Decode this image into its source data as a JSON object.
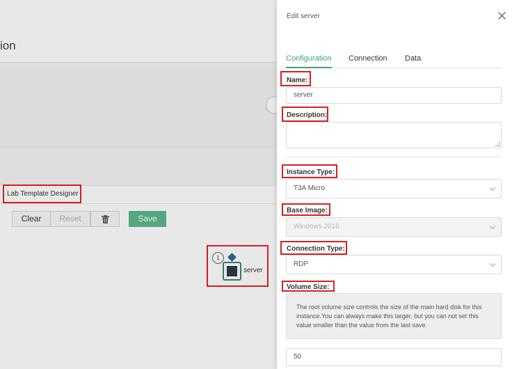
{
  "background": {
    "header_title": "ion",
    "designer_title": "Lab Template Designer",
    "toolbar": {
      "clear_label": "Clear",
      "reset_label": "Reset",
      "delete_icon": "trash-icon",
      "save_label": "Save"
    },
    "node": {
      "number": "1",
      "label": "server"
    }
  },
  "panel": {
    "title": "Edit server",
    "close_icon": "close-icon",
    "tabs": [
      {
        "label": "Configuration",
        "active": true
      },
      {
        "label": "Connection",
        "active": false
      },
      {
        "label": "Data",
        "active": false
      }
    ],
    "fields": {
      "name": {
        "label": "Name:",
        "value": "server"
      },
      "description": {
        "label": "Description:",
        "value": ""
      },
      "instance_type": {
        "label": "Instance Type:",
        "value": "T3A Micro"
      },
      "base_image": {
        "label": "Base Image:",
        "value": "Windows 2016"
      },
      "connection_type": {
        "label": "Connection Type:",
        "value": "RDP"
      },
      "volume_size": {
        "label": "Volume Size:",
        "info": "The root volume size controls the size of the main hard disk for this instance.You can always make this larger, but you can not set this value smaller than the value from the last save.",
        "value": "50"
      }
    }
  },
  "colors": {
    "accent": "#3aa37c",
    "save_button": "#5cb890",
    "annotation": "#d81e1e"
  }
}
